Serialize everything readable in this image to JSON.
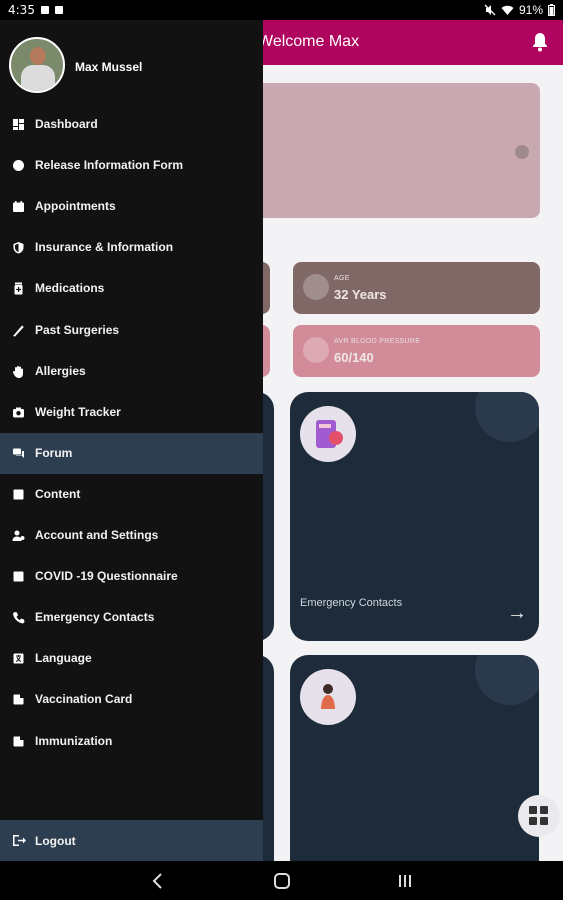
{
  "status_bar": {
    "time": "4:35",
    "battery": "91%",
    "icons": [
      "mute-icon",
      "wifi-icon",
      "battery-icon"
    ]
  },
  "header": {
    "title": "Welcome Max",
    "notification_icon": "bell-icon"
  },
  "stats": [
    {
      "label": "AGE",
      "value": "32 Years"
    },
    {
      "label": "AVR BLOOD PRESSURE",
      "value": "60/140"
    }
  ],
  "cards": [
    {
      "label": "Emergency Contacts",
      "icon": "contacts-icon",
      "arrow_icon": "arrow-right-icon"
    },
    {
      "label": "",
      "icon": "vaccine-icon"
    }
  ],
  "profile": {
    "name": "Max Mussel"
  },
  "menu": [
    {
      "label": "Dashboard",
      "icon": "dashboard-icon",
      "active": false
    },
    {
      "label": "Release Information Form",
      "icon": "info-icon",
      "active": false
    },
    {
      "label": "Appointments",
      "icon": "calendar-icon",
      "active": false
    },
    {
      "label": "Insurance & Information",
      "icon": "shield-icon",
      "active": false
    },
    {
      "label": "Medications",
      "icon": "medication-icon",
      "active": false
    },
    {
      "label": "Past Surgeries",
      "icon": "scalpel-icon",
      "active": false
    },
    {
      "label": "Allergies",
      "icon": "hand-icon",
      "active": false
    },
    {
      "label": "Weight Tracker",
      "icon": "camera-icon",
      "active": false
    },
    {
      "label": "Forum",
      "icon": "forum-icon",
      "active": true
    },
    {
      "label": "Content",
      "icon": "content-icon",
      "active": false
    },
    {
      "label": "Account and Settings",
      "icon": "account-settings-icon",
      "active": false
    },
    {
      "label": "COVID -19 Questionnaire",
      "icon": "questionnaire-icon",
      "active": false
    },
    {
      "label": "Emergency Contacts",
      "icon": "phone-icon",
      "active": false
    },
    {
      "label": "Language",
      "icon": "language-icon",
      "active": false
    },
    {
      "label": "Vaccination Card",
      "icon": "card-icon",
      "active": false
    },
    {
      "label": "Immunization",
      "icon": "immunization-icon",
      "active": false
    }
  ],
  "logout": {
    "label": "Logout",
    "icon": "logout-icon"
  },
  "colors": {
    "header": "#b0055e",
    "drawer_bg": "#121212",
    "active_item": "#2d3e50",
    "card_bg": "#1d2b3a",
    "age_card": "#806866",
    "bp_card": "#d28c99"
  },
  "nav_bar": {
    "buttons": [
      "back-icon",
      "home-icon",
      "recents-icon"
    ]
  }
}
